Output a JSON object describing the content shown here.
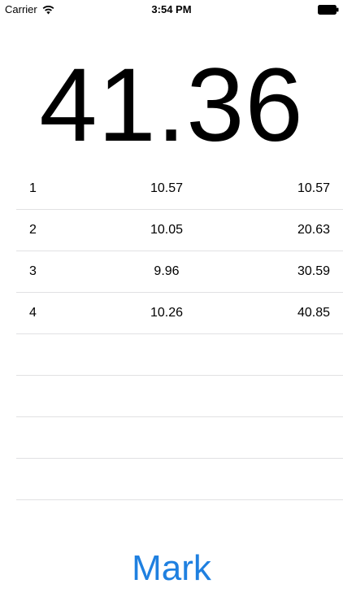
{
  "status_bar": {
    "carrier": "Carrier",
    "time": "3:54 PM",
    "wifi_icon": "wifi-icon",
    "battery_icon": "battery-icon"
  },
  "timer": {
    "display": "41.36"
  },
  "laps": [
    {
      "number": "1",
      "split": "10.57",
      "total": "10.57"
    },
    {
      "number": "2",
      "split": "10.05",
      "total": "20.63"
    },
    {
      "number": "3",
      "split": "9.96",
      "total": "30.59"
    },
    {
      "number": "4",
      "split": "10.26",
      "total": "40.85"
    },
    {
      "number": "",
      "split": "",
      "total": ""
    },
    {
      "number": "",
      "split": "",
      "total": ""
    },
    {
      "number": "",
      "split": "",
      "total": ""
    },
    {
      "number": "",
      "split": "",
      "total": ""
    }
  ],
  "actions": {
    "mark_label": "Mark",
    "accent_color": "#1f80e0"
  }
}
